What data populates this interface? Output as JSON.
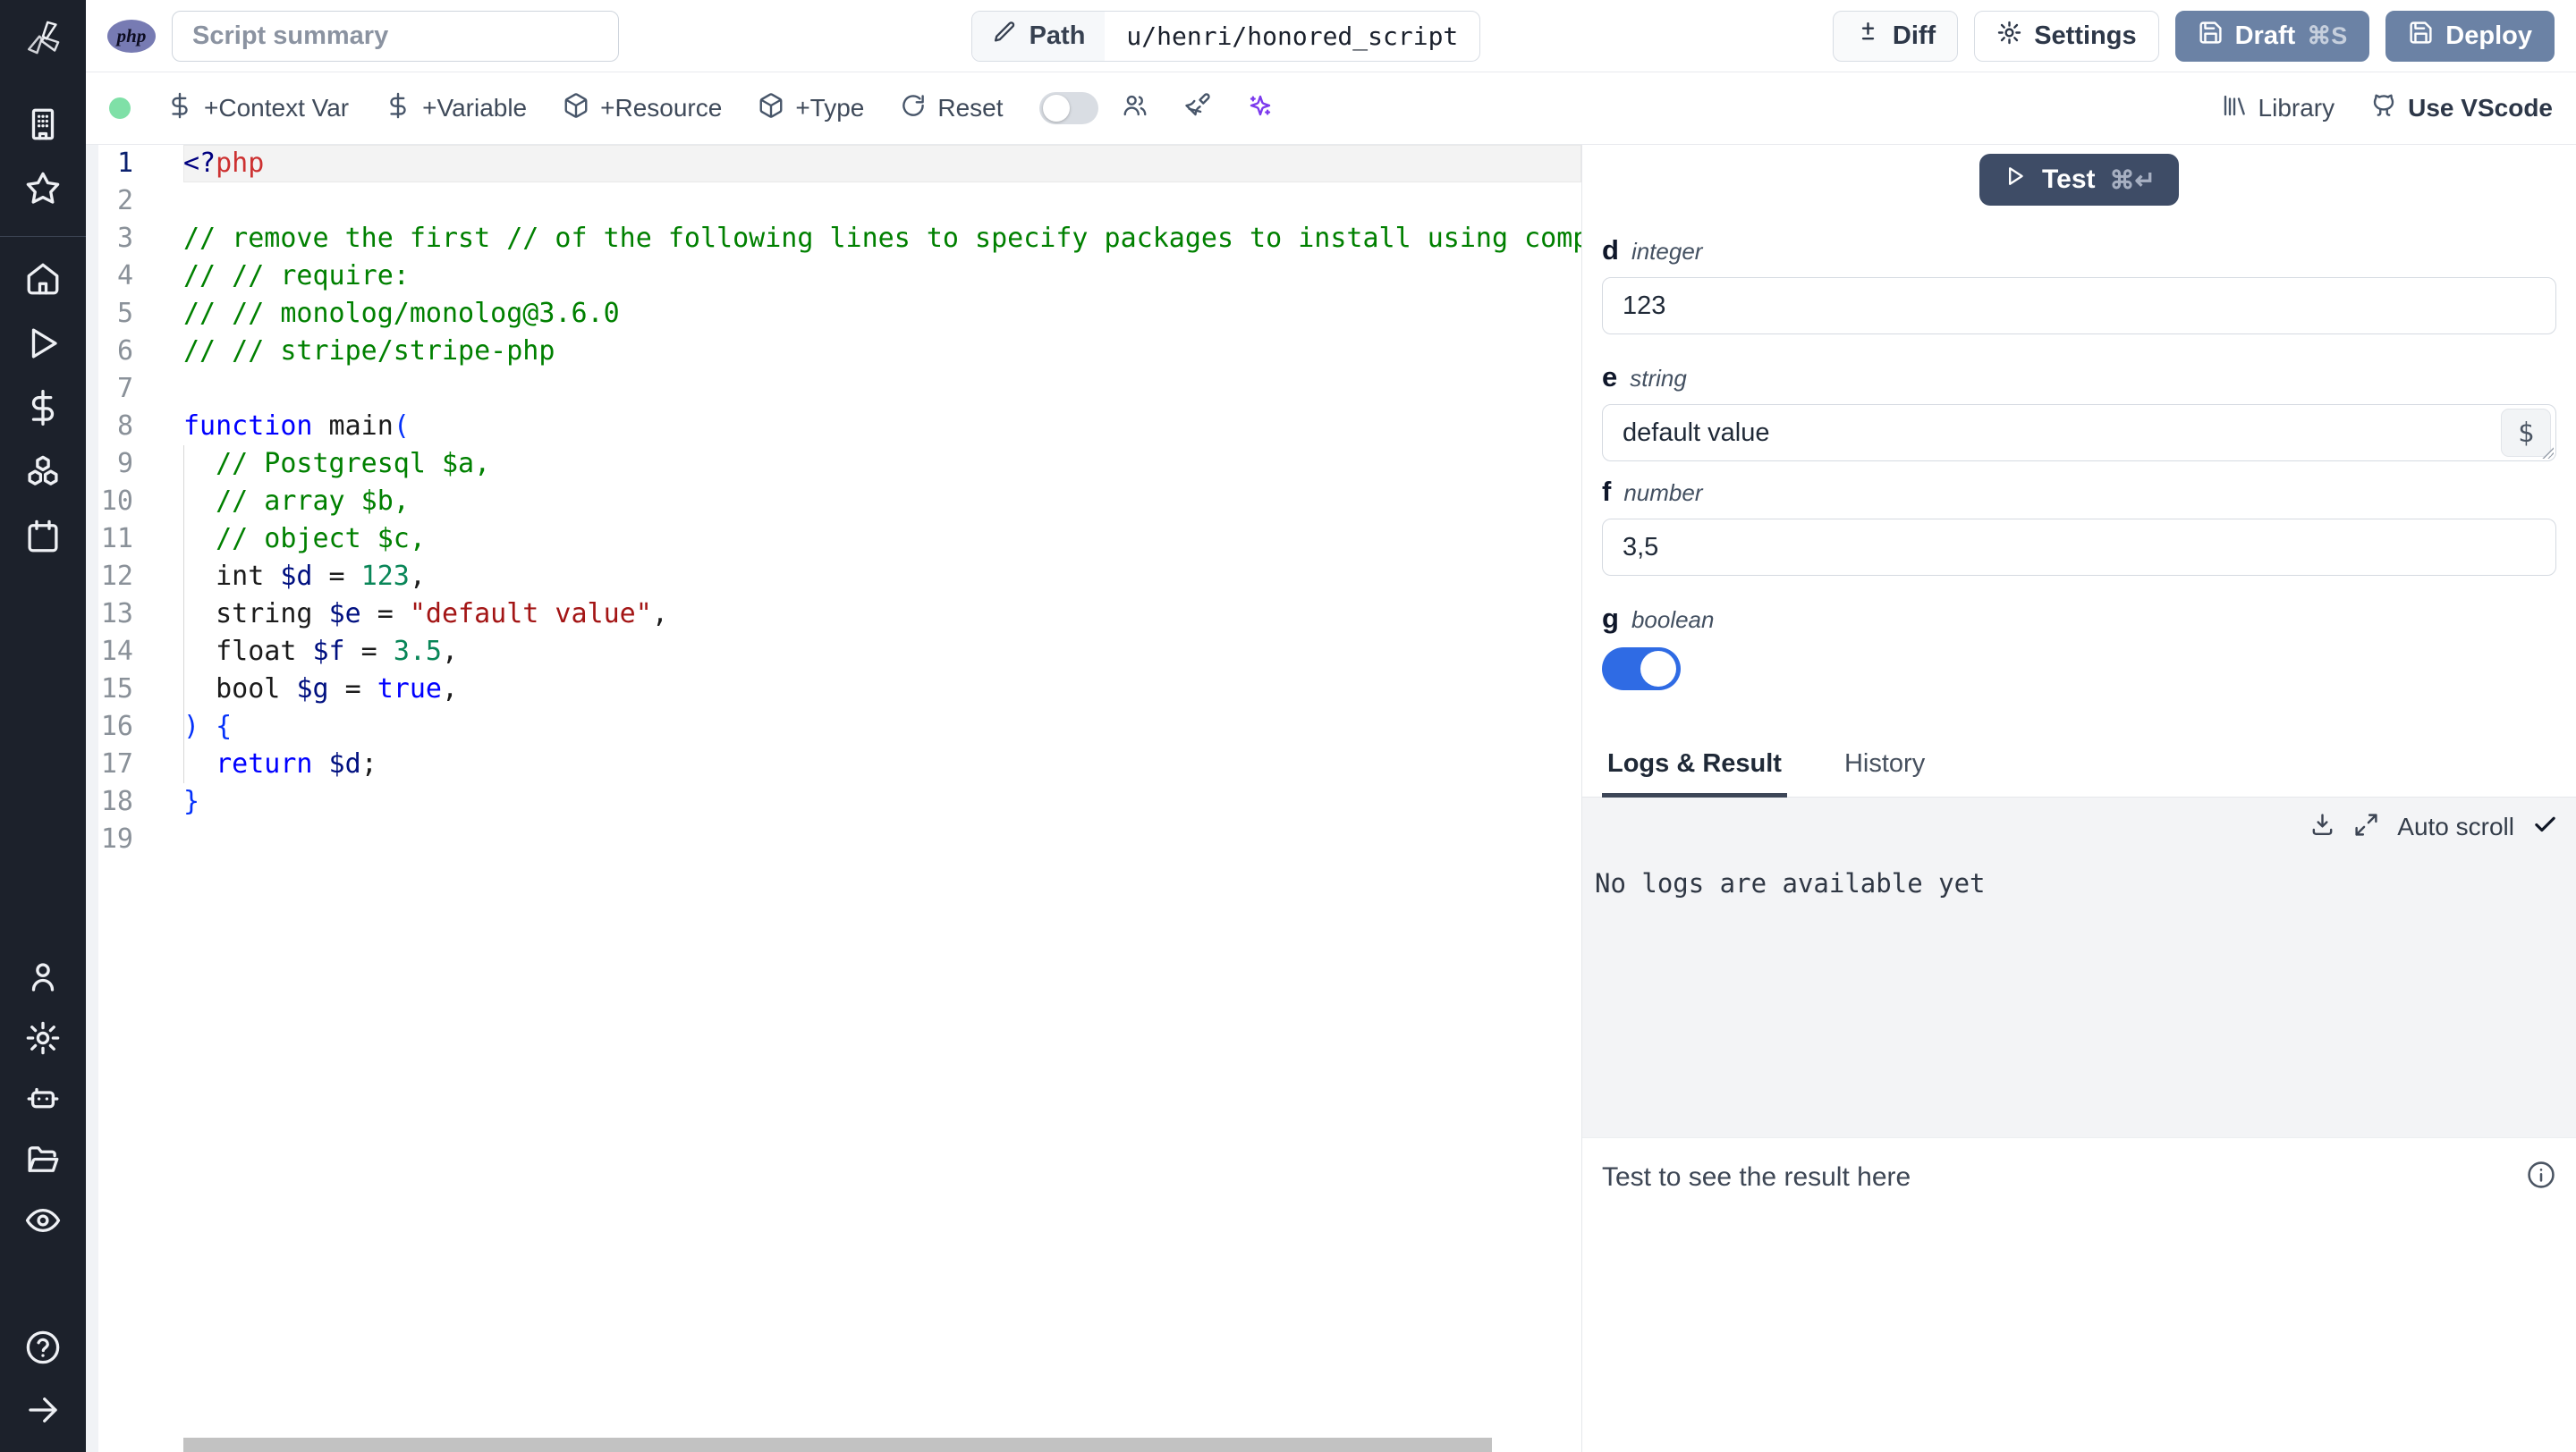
{
  "topbar": {
    "lang_badge": "php",
    "summary_placeholder": "Script summary",
    "path_label": "Path",
    "path_value": "u/henri/honored_script",
    "diff_label": "Diff",
    "settings_label": "Settings",
    "draft_label": "Draft",
    "draft_shortcut": "⌘S",
    "deploy_label": "Deploy"
  },
  "toolbar": {
    "context_var_label": "+Context Var",
    "variable_label": "+Variable",
    "resource_label": "+Resource",
    "type_label": "+Type",
    "reset_label": "Reset",
    "library_label": "Library",
    "vscode_label": "Use VScode"
  },
  "sidebar": {
    "icons": [
      "windmill-logo",
      "building",
      "star",
      "home",
      "play",
      "dollar",
      "boxes",
      "calendar",
      "user",
      "settings-gear",
      "robot",
      "folder",
      "eye",
      "help-circle",
      "arrow-right"
    ]
  },
  "editor": {
    "language": "php",
    "lines": [
      {
        "n": 1,
        "active": true,
        "tokens": [
          {
            "t": "<?",
            "c": "tag"
          },
          {
            "t": "php",
            "c": "phpname"
          }
        ]
      },
      {
        "n": 2,
        "tokens": []
      },
      {
        "n": 3,
        "tokens": [
          {
            "t": "// remove the first // of the following lines to specify packages to install using composer:",
            "c": "com"
          }
        ]
      },
      {
        "n": 4,
        "tokens": [
          {
            "t": "// // require:",
            "c": "com"
          }
        ]
      },
      {
        "n": 5,
        "tokens": [
          {
            "t": "// // monolog/monolog@3.6.0",
            "c": "com"
          }
        ]
      },
      {
        "n": 6,
        "tokens": [
          {
            "t": "// // stripe/stripe-php",
            "c": "com"
          }
        ]
      },
      {
        "n": 7,
        "tokens": []
      },
      {
        "n": 8,
        "tokens": [
          {
            "t": "function",
            "c": "kw"
          },
          {
            "t": " main",
            "c": "plain"
          },
          {
            "t": "(",
            "c": "br"
          }
        ]
      },
      {
        "n": 9,
        "tokens": [
          {
            "t": "  // Postgresql $a,",
            "c": "com"
          }
        ]
      },
      {
        "n": 10,
        "tokens": [
          {
            "t": "  // array $b,",
            "c": "com"
          }
        ]
      },
      {
        "n": 11,
        "tokens": [
          {
            "t": "  // object $c,",
            "c": "com"
          }
        ]
      },
      {
        "n": 12,
        "tokens": [
          {
            "t": "  int ",
            "c": "plain"
          },
          {
            "t": "$d",
            "c": "var"
          },
          {
            "t": " = ",
            "c": "plain"
          },
          {
            "t": "123",
            "c": "num"
          },
          {
            "t": ",",
            "c": "plain"
          }
        ]
      },
      {
        "n": 13,
        "tokens": [
          {
            "t": "  string ",
            "c": "plain"
          },
          {
            "t": "$e",
            "c": "var"
          },
          {
            "t": " = ",
            "c": "plain"
          },
          {
            "t": "\"default value\"",
            "c": "str"
          },
          {
            "t": ",",
            "c": "plain"
          }
        ]
      },
      {
        "n": 14,
        "tokens": [
          {
            "t": "  float ",
            "c": "plain"
          },
          {
            "t": "$f",
            "c": "var"
          },
          {
            "t": " = ",
            "c": "plain"
          },
          {
            "t": "3.5",
            "c": "num"
          },
          {
            "t": ",",
            "c": "plain"
          }
        ]
      },
      {
        "n": 15,
        "tokens": [
          {
            "t": "  bool ",
            "c": "plain"
          },
          {
            "t": "$g",
            "c": "var"
          },
          {
            "t": " = ",
            "c": "plain"
          },
          {
            "t": "true",
            "c": "kw"
          },
          {
            "t": ",",
            "c": "plain"
          }
        ]
      },
      {
        "n": 16,
        "tokens": [
          {
            "t": ") {",
            "c": "br"
          }
        ]
      },
      {
        "n": 17,
        "tokens": [
          {
            "t": "  return",
            "c": "kw"
          },
          {
            "t": " $d",
            "c": "var"
          },
          {
            "t": ";",
            "c": "plain"
          }
        ]
      },
      {
        "n": 18,
        "tokens": [
          {
            "t": "}",
            "c": "br"
          }
        ]
      },
      {
        "n": 19,
        "tokens": []
      }
    ]
  },
  "panel": {
    "test_label": "Test",
    "test_shortcut": "⌘↵",
    "fields": [
      {
        "name": "d",
        "type": "integer",
        "value": "123",
        "kind": "input"
      },
      {
        "name": "e",
        "type": "string",
        "value": "default value",
        "kind": "textarea",
        "dollar_button": "$"
      },
      {
        "name": "f",
        "type": "number",
        "value": "3,5",
        "kind": "input"
      },
      {
        "name": "g",
        "type": "boolean",
        "value": true,
        "kind": "toggle"
      }
    ],
    "tabs": [
      "Logs & Result",
      "History"
    ],
    "active_tab": "Logs & Result",
    "auto_scroll_label": "Auto scroll",
    "no_logs_text": "No logs are available yet",
    "result_hint": "Test to see the result here"
  },
  "colors": {
    "sidebar_bg": "#1c212b",
    "primary_button": "#6b82a5",
    "test_button": "#3e4c66",
    "toggle_on": "#2f6be4",
    "green_dot": "#7fe0a7",
    "php_badge": "#777bb3",
    "ai_sparkle": "#7c3aed",
    "comment": "#008000",
    "keyword": "#0000ff",
    "string": "#a31515",
    "number": "#098658"
  }
}
